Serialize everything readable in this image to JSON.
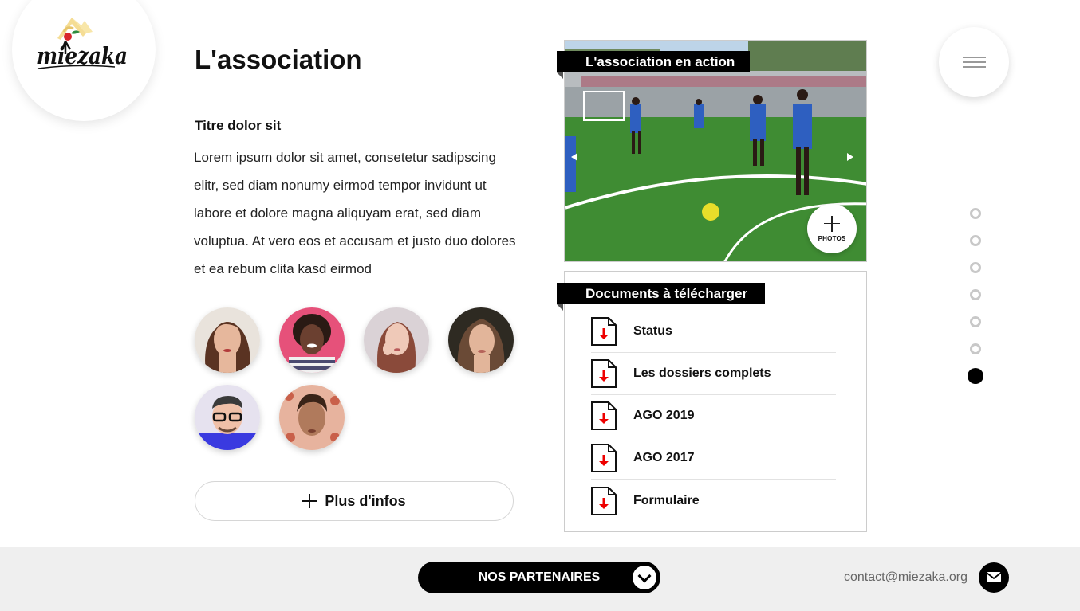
{
  "logo": {
    "text": "miezaka"
  },
  "main": {
    "title": "L'association",
    "subtitle": "Titre dolor sit",
    "body": "Lorem ipsum dolor sit amet, consetetur sadipscing elitr, sed diam nonumy eirmod tempor invidunt ut labore et dolore magna aliquyam erat, sed diam voluptua. At vero eos et accusam et justo duo dolores et ea rebum clita kasd eirmod",
    "more_label": "Plus d'infos"
  },
  "gallery": {
    "title": "L'association en action",
    "photos_label": "PHOTOS"
  },
  "documents": {
    "title": "Documents à télécharger",
    "items": [
      {
        "label": "Status"
      },
      {
        "label": "Les dossiers complets"
      },
      {
        "label": "AGO 2019"
      },
      {
        "label": "AGO 2017"
      },
      {
        "label": "Formulaire"
      }
    ]
  },
  "pagination": {
    "total": 7,
    "active": 7
  },
  "footer": {
    "partners_label": "NOS PARTENAIRES",
    "contact_email": "contact@miezaka.org"
  },
  "colors": {
    "accent": "#000000",
    "footer_bg": "#efefef",
    "download_arrow": "#e00000"
  }
}
